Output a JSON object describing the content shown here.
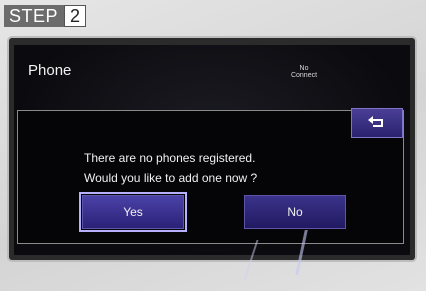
{
  "step": {
    "word": "STEP",
    "number": "2"
  },
  "screen": {
    "title": "Phone",
    "status": "No\nConnect",
    "back_icon": "return-arrow-icon"
  },
  "dialog": {
    "message_line1": "There are no phones registered.",
    "message_line2": "Would you like to add one now ?",
    "yes_label": "Yes",
    "no_label": "No"
  },
  "colors": {
    "button_bg": "#2a2370",
    "selected_outline": "#b6b0ff",
    "screen_bg": "#0b0b0f",
    "step_badge": "#6c6c6c"
  }
}
